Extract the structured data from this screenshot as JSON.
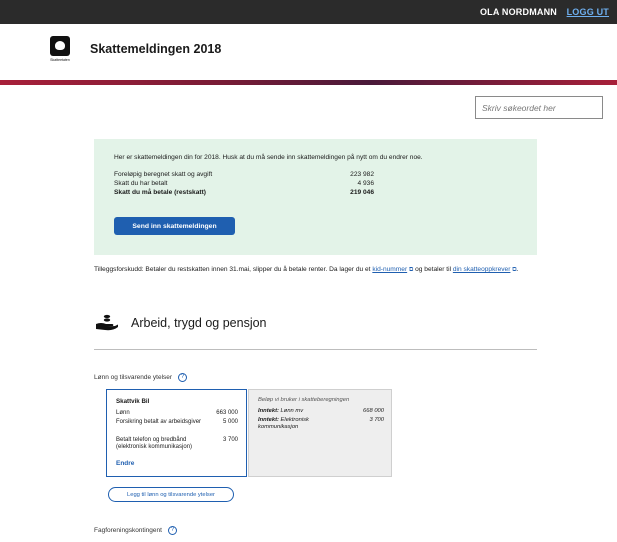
{
  "header": {
    "user_name": "OLA NORDMANN",
    "logout": "LOGG UT"
  },
  "app": {
    "title": "Skattemeldingen 2018",
    "logo_text": "Skatteetaten"
  },
  "search": {
    "placeholder": "Skriv søkeordet her"
  },
  "summary": {
    "intro": "Her er skattemeldingen din for 2018. Husk at du må sende inn skattemeldingen på nytt om du endrer noe.",
    "rows": [
      {
        "label": "Foreløpig beregnet skatt og avgift",
        "value": "223 982"
      },
      {
        "label": "Skatt du har betalt",
        "value": "4 936"
      },
      {
        "label": "Skatt du må betale (restskatt)",
        "value": "219 046"
      }
    ],
    "send_button": "Send inn skattemeldingen"
  },
  "note": {
    "text1": "Tilleggsforskudd: Betaler du restskatten innen 31.mai, slipper du å betale renter. Da lager du et ",
    "link1": "kid-nummer",
    "text2": " og betaler til ",
    "link2": "din skatteoppkrever",
    "text3": "."
  },
  "section": {
    "title": "Arbeid, trygd og pensjon",
    "icon": "hand-coins-icon"
  },
  "income": {
    "heading": "Lønn og tilsvarende ytelser",
    "help": "?",
    "card": {
      "employer": "Skattvik Bil",
      "lines": [
        {
          "label": "Lønn",
          "value": "663 000"
        },
        {
          "label": "Forsikring betalt av arbeidsgiver",
          "value": "5 000"
        },
        {
          "label": "Betalt telefon og bredbånd (elektronisk kommunikasjon)",
          "value": "3 700"
        }
      ],
      "edit": "Endre"
    },
    "calc": {
      "heading": "Beløp vi bruker i skatteberegningen",
      "lines": [
        {
          "label_bold": "Inntekt:",
          "label": " Lønn mv",
          "value": "668 000"
        },
        {
          "label_bold": "Inntekt:",
          "label": " Elektronisk kommunikasjon",
          "value": "3 700"
        }
      ]
    },
    "add_button": "Legg til lønn og tilsvarende ytelser"
  },
  "union": {
    "heading": "Fagforeningskontingent",
    "help": "?"
  }
}
